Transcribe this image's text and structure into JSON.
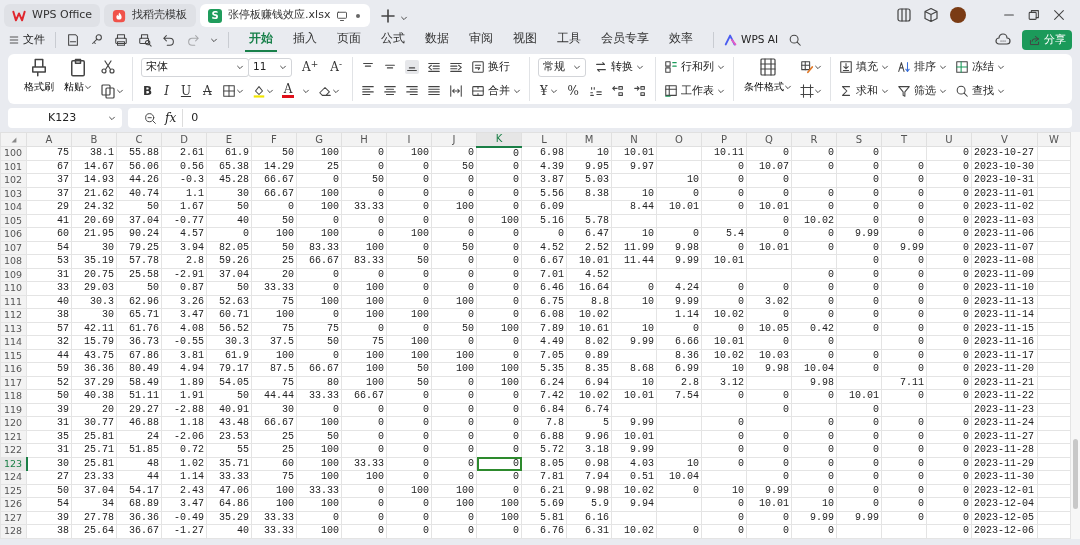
{
  "window_tabs": [
    {
      "kind": "home",
      "label": "WPS Office",
      "selected": false
    },
    {
      "kind": "template",
      "label": "找稻壳模板",
      "selected": false
    },
    {
      "kind": "sheet",
      "badge": "S",
      "label": "张停板赚钱效应.xlsx",
      "selected": true
    }
  ],
  "menu": {
    "file": "文件",
    "ai": "WPS AI",
    "share": "分享"
  },
  "ribbon_tabs": [
    {
      "label": "开始",
      "selected": true
    },
    {
      "label": "插入",
      "selected": false
    },
    {
      "label": "页面",
      "selected": false
    },
    {
      "label": "公式",
      "selected": false
    },
    {
      "label": "数据",
      "selected": false
    },
    {
      "label": "审阅",
      "selected": false
    },
    {
      "label": "视图",
      "selected": false
    },
    {
      "label": "工具",
      "selected": false
    },
    {
      "label": "会员专享",
      "selected": false
    },
    {
      "label": "效率",
      "selected": false
    }
  ],
  "ribbon": {
    "format_painter": "格式刷",
    "paste": "粘贴",
    "font_name": "宋体",
    "font_size": "11",
    "grow_font": "A$^{+}$",
    "shrink_font": "A$^{-}$",
    "bold": "B",
    "italic": "I",
    "underline": "U",
    "strikethrough": "A",
    "font_color": "A",
    "wrap": "换行",
    "merge": "合并",
    "number_format": "常规",
    "convert": "转换",
    "currency": "¥",
    "percent": "%",
    "rows_cols": "行和列",
    "worksheet": "工作表",
    "conditional_format": "条件格式",
    "fill": "填充",
    "sort": "排序",
    "freeze": "冻结",
    "sum": "求和",
    "filter": "筛选",
    "find": "查找"
  },
  "formula_bar": {
    "name_box": "K123",
    "fx": "fx",
    "value": "0"
  },
  "sheet": {
    "columns": [
      {
        "label": "A",
        "selected": false
      },
      {
        "label": "B",
        "selected": false
      },
      {
        "label": "C",
        "selected": false
      },
      {
        "label": "D",
        "selected": false
      },
      {
        "label": "E",
        "selected": false
      },
      {
        "label": "F",
        "selected": false
      },
      {
        "label": "G",
        "selected": false
      },
      {
        "label": "H",
        "selected": false
      },
      {
        "label": "I",
        "selected": false
      },
      {
        "label": "J",
        "selected": false
      },
      {
        "label": "K",
        "selected": true
      },
      {
        "label": "L",
        "selected": false
      },
      {
        "label": "M",
        "selected": false
      },
      {
        "label": "N",
        "selected": false
      },
      {
        "label": "O",
        "selected": false
      },
      {
        "label": "P",
        "selected": false
      },
      {
        "label": "Q",
        "selected": false
      },
      {
        "label": "R",
        "selected": false
      },
      {
        "label": "S",
        "selected": false
      },
      {
        "label": "T",
        "selected": false
      },
      {
        "label": "U",
        "selected": false
      },
      {
        "label": "V",
        "selected": false
      },
      {
        "label": "W",
        "selected": false
      }
    ],
    "rows": [
      {
        "label": "100",
        "selected": false,
        "cells": [
          "75",
          "38.1",
          "55.88",
          "2.61",
          "61.9",
          "50",
          "100",
          "0",
          "100",
          "0",
          "0",
          "6.98",
          "10",
          "10.01",
          null,
          "10.11",
          "0",
          "0",
          "0",
          null,
          "0",
          "2023-10-27"
        ]
      },
      {
        "label": "101",
        "selected": false,
        "cells": [
          "67",
          "14.67",
          "56.06",
          "0.56",
          "65.38",
          "14.29",
          "25",
          "0",
          "0",
          "50",
          "0",
          "4.39",
          "9.95",
          "9.97",
          null,
          "0",
          "10.07",
          "0",
          "0",
          "0",
          "0",
          "2023-10-30"
        ]
      },
      {
        "label": "102",
        "selected": false,
        "cells": [
          "37",
          "14.93",
          "44.26",
          "-0.3",
          "45.28",
          "66.67",
          "0",
          "50",
          "0",
          "0",
          "0",
          "3.87",
          "5.03",
          null,
          "10",
          "0",
          "0",
          null,
          "0",
          "0",
          "0",
          "2023-10-31"
        ]
      },
      {
        "label": "103",
        "selected": false,
        "cells": [
          "37",
          "21.62",
          "40.74",
          "1.1",
          "30",
          "66.67",
          "100",
          "0",
          "0",
          "0",
          "0",
          "5.56",
          "8.38",
          "10",
          "0",
          "0",
          "0",
          "0",
          "0",
          "0",
          "0",
          "2023-11-01"
        ]
      },
      {
        "label": "104",
        "selected": false,
        "cells": [
          "29",
          "24.32",
          "50",
          "1.67",
          "50",
          "0",
          "100",
          "33.33",
          "0",
          "100",
          "0",
          "6.09",
          null,
          "8.44",
          "10.01",
          "0",
          "10.01",
          "0",
          "0",
          "0",
          "0",
          "2023-11-02"
        ]
      },
      {
        "label": "105",
        "selected": false,
        "cells": [
          "41",
          "20.69",
          "37.04",
          "-0.77",
          "40",
          "50",
          "0",
          "0",
          "0",
          "0",
          "100",
          "5.16",
          "5.78",
          null,
          null,
          null,
          "0",
          "10.02",
          "0",
          "0",
          "0",
          "2023-11-03"
        ]
      },
      {
        "label": "106",
        "selected": false,
        "cells": [
          "60",
          "21.95",
          "90.24",
          "4.57",
          "0",
          "100",
          "100",
          "0",
          "100",
          "0",
          "0",
          "0",
          "6.47",
          "10",
          "0",
          "5.4",
          "0",
          "0",
          "9.99",
          "0",
          "0",
          "2023-11-06"
        ]
      },
      {
        "label": "107",
        "selected": false,
        "cells": [
          "54",
          "30",
          "79.25",
          "3.94",
          "82.05",
          "50",
          "83.33",
          "100",
          "0",
          "50",
          "0",
          "4.52",
          "2.52",
          "11.99",
          "9.98",
          "0",
          "10.01",
          "0",
          "0",
          "9.99",
          "0",
          "2023-11-07"
        ]
      },
      {
        "label": "108",
        "selected": false,
        "cells": [
          "53",
          "35.19",
          "57.78",
          "2.8",
          "59.26",
          "25",
          "66.67",
          "83.33",
          "50",
          "0",
          "0",
          "6.67",
          "10.01",
          "11.44",
          "9.99",
          "10.01",
          null,
          null,
          "0",
          "0",
          "0",
          "2023-11-08"
        ]
      },
      {
        "label": "109",
        "selected": false,
        "cells": [
          "31",
          "20.75",
          "25.58",
          "-2.91",
          "37.04",
          "20",
          "0",
          "0",
          "0",
          "0",
          "0",
          "7.01",
          "4.52",
          null,
          null,
          null,
          null,
          "0",
          "0",
          "0",
          "0",
          "2023-11-09"
        ]
      },
      {
        "label": "110",
        "selected": false,
        "cells": [
          "33",
          "29.03",
          "50",
          "0.87",
          "50",
          "33.33",
          "0",
          "100",
          "0",
          "0",
          "0",
          "6.46",
          "16.64",
          "0",
          "4.24",
          "0",
          "0",
          "0",
          "0",
          "0",
          "0",
          "2023-11-10"
        ]
      },
      {
        "label": "111",
        "selected": false,
        "cells": [
          "40",
          "30.3",
          "62.96",
          "3.26",
          "52.63",
          "75",
          "100",
          "100",
          "0",
          "100",
          "0",
          "6.75",
          "8.8",
          "10",
          "9.99",
          "0",
          "3.02",
          "0",
          "0",
          "0",
          "0",
          "2023-11-13"
        ]
      },
      {
        "label": "112",
        "selected": false,
        "cells": [
          "38",
          "30",
          "65.71",
          "3.47",
          "60.71",
          "100",
          "0",
          "100",
          "100",
          "0",
          "0",
          "6.08",
          "10.02",
          null,
          "1.14",
          "10.02",
          "0",
          "0",
          "0",
          "0",
          "0",
          "2023-11-14"
        ]
      },
      {
        "label": "113",
        "selected": false,
        "cells": [
          "57",
          "42.11",
          "61.76",
          "4.08",
          "56.52",
          "75",
          "75",
          "0",
          "0",
          "50",
          "100",
          "7.89",
          "10.61",
          "10",
          "0",
          "0",
          "10.05",
          "0.42",
          "0",
          "0",
          "0",
          "2023-11-15"
        ]
      },
      {
        "label": "114",
        "selected": false,
        "cells": [
          "32",
          "15.79",
          "36.73",
          "-0.55",
          "30.3",
          "37.5",
          "50",
          "75",
          "100",
          "0",
          "0",
          "4.49",
          "8.02",
          "9.99",
          "6.66",
          "10.01",
          "0",
          "0",
          null,
          "0",
          "0",
          "2023-11-16"
        ]
      },
      {
        "label": "115",
        "selected": false,
        "cells": [
          "44",
          "43.75",
          "67.86",
          "3.81",
          "61.9",
          "100",
          "0",
          "100",
          "100",
          "100",
          "0",
          "7.05",
          "0.89",
          null,
          "8.36",
          "10.02",
          "10.03",
          "0",
          "0",
          "0",
          "0",
          "2023-11-17"
        ]
      },
      {
        "label": "116",
        "selected": false,
        "cells": [
          "59",
          "36.36",
          "80.49",
          "4.94",
          "79.17",
          "87.5",
          "66.67",
          "100",
          "50",
          "100",
          "100",
          "5.35",
          "8.35",
          "8.68",
          "6.99",
          "10",
          "9.98",
          "10.04",
          "0",
          "0",
          "0",
          "2023-11-20"
        ]
      },
      {
        "label": "117",
        "selected": false,
        "cells": [
          "52",
          "37.29",
          "58.49",
          "1.89",
          "54.05",
          "75",
          "80",
          "100",
          "50",
          "0",
          "100",
          "6.24",
          "6.94",
          "10",
          "2.8",
          "3.12",
          null,
          "9.98",
          null,
          "7.11",
          "0",
          "2023-11-21"
        ]
      },
      {
        "label": "118",
        "selected": false,
        "cells": [
          "50",
          "40.38",
          "51.11",
          "1.91",
          "50",
          "44.44",
          "33.33",
          "66.67",
          "0",
          "0",
          "0",
          "7.42",
          "10.02",
          "10.01",
          "7.54",
          "0",
          "0",
          "0",
          "10.01",
          "0",
          "0",
          "2023-11-22"
        ]
      },
      {
        "label": "119",
        "selected": false,
        "cells": [
          "39",
          "20",
          "29.27",
          "-2.88",
          "40.91",
          "30",
          "0",
          "0",
          "0",
          "0",
          "0",
          "6.84",
          "6.74",
          null,
          null,
          null,
          "0",
          null,
          "0",
          null,
          null,
          "2023-11-23"
        ]
      },
      {
        "label": "120",
        "selected": false,
        "cells": [
          "31",
          "30.77",
          "46.88",
          "1.18",
          "43.48",
          "66.67",
          "100",
          "0",
          "0",
          "0",
          "0",
          "7.8",
          "5",
          "9.99",
          null,
          "0",
          null,
          "0",
          "0",
          "0",
          "0",
          "2023-11-24"
        ]
      },
      {
        "label": "121",
        "selected": false,
        "cells": [
          "35",
          "25.81",
          "24",
          "-2.06",
          "23.53",
          "25",
          "50",
          "0",
          "0",
          "0",
          "0",
          "6.88",
          "9.96",
          "10.01",
          null,
          "0",
          "0",
          "0",
          "0",
          "0",
          "0",
          "2023-11-27"
        ]
      },
      {
        "label": "122",
        "selected": false,
        "cells": [
          "31",
          "25.71",
          "51.85",
          "0.72",
          "55",
          "25",
          "100",
          "0",
          "0",
          "0",
          "0",
          "5.72",
          "3.18",
          "9.99",
          null,
          "0",
          "0",
          "0",
          "0",
          "0",
          "0",
          "2023-11-28"
        ]
      },
      {
        "label": "123",
        "selected": true,
        "cells": [
          "30",
          "25.81",
          "48",
          "1.02",
          "35.71",
          "60",
          "100",
          "33.33",
          "0",
          "0",
          "0",
          "8.05",
          "0.98",
          "4.03",
          "10",
          "0",
          "0",
          "0",
          "0",
          "0",
          "0",
          "2023-11-29"
        ]
      },
      {
        "label": "124",
        "selected": false,
        "cells": [
          "27",
          "23.33",
          "44",
          "1.14",
          "33.33",
          "75",
          "100",
          "100",
          "0",
          "0",
          "0",
          "7.81",
          "7.94",
          "0.51",
          "10.04",
          null,
          "0",
          "0",
          "0",
          "0",
          "0",
          "2023-11-30"
        ]
      },
      {
        "label": "125",
        "selected": false,
        "cells": [
          "50",
          "37.04",
          "54.17",
          "2.43",
          "47.06",
          "100",
          "33.33",
          "0",
          "100",
          "100",
          "0",
          "6.21",
          "9.98",
          "10.02",
          "0",
          "10",
          "9.99",
          "0",
          "0",
          "0",
          "0",
          "2023-12-01"
        ]
      },
      {
        "label": "126",
        "selected": false,
        "cells": [
          "54",
          "34",
          "68.89",
          "3.47",
          "64.86",
          "100",
          "100",
          "0",
          "0",
          "100",
          "100",
          "5.69",
          "5.9",
          "9.94",
          null,
          "0",
          "10.01",
          "10",
          "0",
          "0",
          "0",
          "2023-12-04"
        ]
      },
      {
        "label": "127",
        "selected": false,
        "cells": [
          "39",
          "27.78",
          "36.36",
          "-0.49",
          "35.29",
          "33.33",
          "0",
          "0",
          "0",
          "0",
          "100",
          "5.81",
          "6.16",
          null,
          null,
          "0",
          "0",
          "9.99",
          "9.99",
          "0",
          "0",
          "2023-12-05"
        ]
      },
      {
        "label": "128",
        "selected": false,
        "cells": [
          "38",
          "25.64",
          "36.67",
          "-1.27",
          "40",
          "33.33",
          "100",
          "0",
          "0",
          "0",
          "0",
          "6.76",
          "6.31",
          "10.02",
          "0",
          "0",
          "0",
          "0",
          null,
          null,
          "0",
          "2023-12-06"
        ]
      }
    ]
  }
}
